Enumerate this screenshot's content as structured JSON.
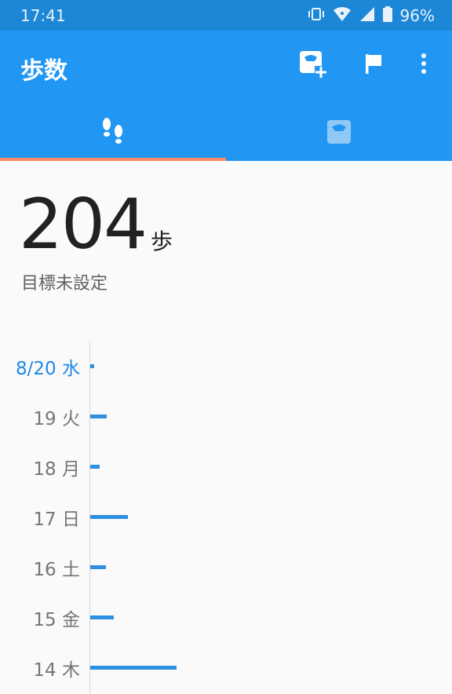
{
  "status_bar": {
    "time": "17:41",
    "battery_percent": "96%",
    "icons": [
      "vibrate-icon",
      "wifi-icon",
      "cell-signal-icon",
      "battery-icon"
    ]
  },
  "app_bar": {
    "title": "歩数",
    "actions": [
      "scale-add-icon",
      "flag-icon",
      "more-vert-icon"
    ],
    "tabs": [
      {
        "icon": "footsteps-icon",
        "selected": true
      },
      {
        "icon": "scale-icon",
        "selected": false
      }
    ],
    "accent_color": "#2196f3",
    "indicator_color": "#ff8a65"
  },
  "summary": {
    "steps": "204",
    "unit": "歩",
    "goal": "目標未設定"
  },
  "chart_data": {
    "type": "bar",
    "orientation": "horizontal",
    "categories": [
      "8/20 水",
      "19 火",
      "18 月",
      "17 日",
      "16 土",
      "15 金",
      "14 木"
    ],
    "values": [
      204,
      900,
      500,
      2100,
      850,
      1300,
      4800
    ],
    "highlight_category": "8/20 水",
    "bar_color": "#2f8fe0",
    "xlim": [
      0,
      20000
    ]
  }
}
